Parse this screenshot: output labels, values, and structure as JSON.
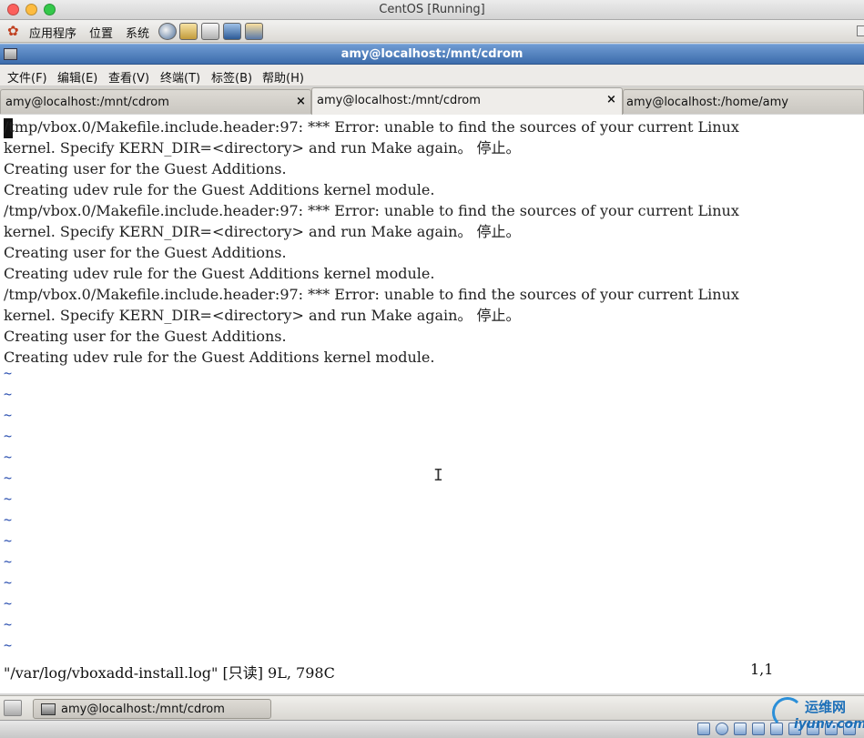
{
  "window": {
    "title": "CentOS [Running]"
  },
  "gnome_panel": {
    "applications_label": "应用程序",
    "places_label": "位置",
    "system_label": "系统",
    "launchers": [
      "browser-icon",
      "mail-icon",
      "notes-icon",
      "screenshot-icon",
      "network-icon"
    ]
  },
  "terminal_window": {
    "title": "amy@localhost:/mnt/cdrom",
    "menu": [
      "文件(F)",
      "编辑(E)",
      "查看(V)",
      "终端(T)",
      "标签(B)",
      "帮助(H)"
    ],
    "tabs": [
      {
        "label": "amy@localhost:/mnt/cdrom",
        "close": "×",
        "active": false
      },
      {
        "label": "amy@localhost:/mnt/cdrom",
        "close": "×",
        "active": true
      },
      {
        "label": "amy@localhost:/home/amy",
        "close": "",
        "active": false
      }
    ],
    "lines": [
      "/tmp/vbox.0/Makefile.include.header:97: *** Error: unable to find the sources of your current Linux",
      "kernel. Specify KERN_DIR=<directory> and run Make again。 停止。",
      "Creating user for the Guest Additions.",
      "Creating udev rule for the Guest Additions kernel module.",
      "/tmp/vbox.0/Makefile.include.header:97: *** Error: unable to find the sources of your current Linux",
      "kernel. Specify KERN_DIR=<directory> and run Make again。 停止。",
      "Creating user for the Guest Additions.",
      "Creating udev rule for the Guest Additions kernel module.",
      "/tmp/vbox.0/Makefile.include.header:97: *** Error: unable to find the sources of your current Linux",
      "kernel. Specify KERN_DIR=<directory> and run Make again。 停止。",
      "Creating user for the Guest Additions.",
      "Creating udev rule for the Guest Additions kernel module."
    ],
    "tilde": "~",
    "status_left": "\"/var/log/vboxadd-install.log\" [只读] 9L, 798C",
    "status_right": "1,1"
  },
  "taskbar": {
    "task_label": "amy@localhost:/mnt/cdrom"
  },
  "watermark": {
    "cn": "运维网",
    "en": "iyunv.com"
  },
  "colors": {
    "titlebar_blue": "#3c6cab",
    "tilde_blue": "#2a4fb0",
    "terminal_bg": "#ffffff"
  }
}
